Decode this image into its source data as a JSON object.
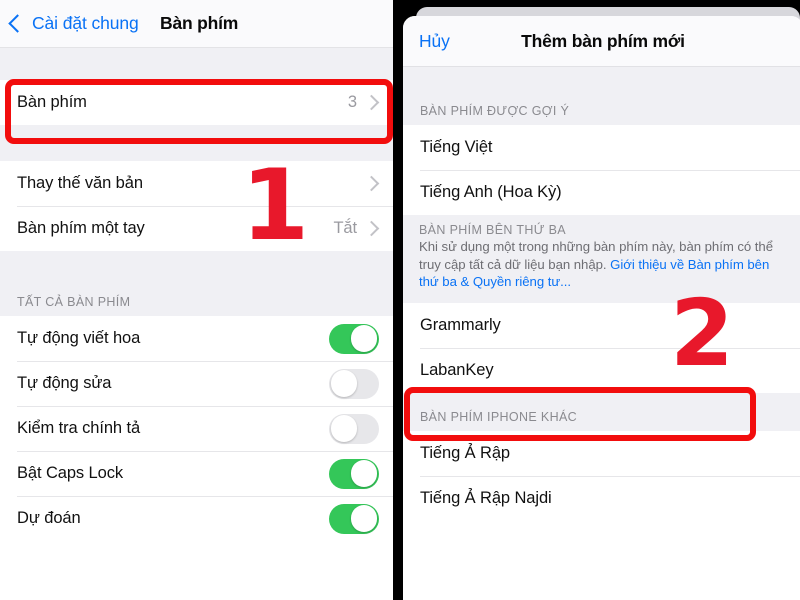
{
  "left_panel": {
    "nav": {
      "back_label": "Cài đặt chung",
      "back_icon": "chevron-left-icon",
      "title": "Bàn phím"
    },
    "group_keyboards": [
      {
        "label": "Bàn phím",
        "value": "3",
        "accessory": "chevron-right-icon"
      }
    ],
    "group_text": [
      {
        "label": "Thay thế văn bản",
        "value": "",
        "accessory": "chevron-right-icon"
      },
      {
        "label": "Bàn phím một tay",
        "value": "Tắt",
        "accessory": "chevron-right-icon"
      }
    ],
    "all_keyboards_header": "TẤT CẢ BÀN PHÍM",
    "group_toggles": [
      {
        "label": "Tự động viết hoa",
        "state": "on"
      },
      {
        "label": "Tự động sửa",
        "state": "off"
      },
      {
        "label": "Kiểm tra chính tả",
        "state": "off"
      },
      {
        "label": "Bật Caps Lock",
        "state": "on"
      },
      {
        "label": "Dự đoán",
        "state": "on"
      }
    ]
  },
  "right_panel": {
    "nav": {
      "cancel_label": "Hủy",
      "title": "Thêm bàn phím mới"
    },
    "suggested_header": "BÀN PHÍM ĐƯỢC GỢI Ý",
    "suggested_items": [
      {
        "label": "Tiếng Việt"
      },
      {
        "label": "Tiếng Anh (Hoa Kỳ)"
      }
    ],
    "third_party": {
      "header": "BÀN PHÍM BÊN THỨ BA",
      "body_text": "Khi sử dụng một trong những bàn phím này, bàn phím có thể truy cập tất cả dữ liệu bạn nhập. ",
      "link_text": "Giới thiệu về Bàn phím bên thứ ba & Quyền riêng tư..."
    },
    "third_party_items": [
      {
        "label": "Grammarly"
      },
      {
        "label": "LabanKey"
      }
    ],
    "other_header": "BÀN PHÍM IPHONE KHÁC",
    "other_items": [
      {
        "label": "Tiếng Ả Rập"
      },
      {
        "label": "Tiếng Ả Rập Najdi"
      }
    ]
  },
  "annotations": {
    "step_one": "1",
    "step_two": "2",
    "highlight_color": "#F20D0D",
    "number_color": "#E8182B"
  }
}
